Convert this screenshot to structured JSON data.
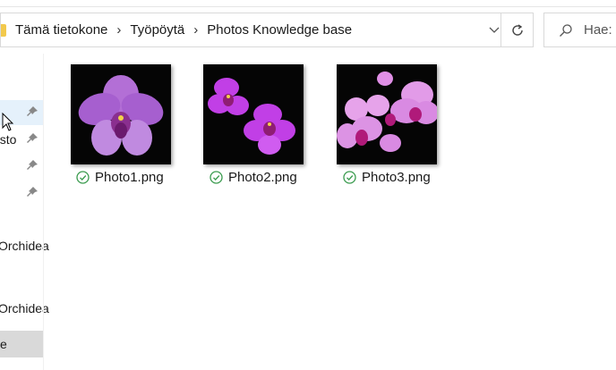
{
  "breadcrumb": [
    "Tämä tietokone",
    "Työpöytä",
    "Photos Knowledge base"
  ],
  "search": {
    "placeholder": "Hae:"
  },
  "sidebar": {
    "items": [
      {
        "label": "osto"
      },
      {
        "label": "Orchidea"
      },
      {
        "label": "Orchidea"
      },
      {
        "label": "e"
      }
    ]
  },
  "files": [
    {
      "name": "Photo1.png",
      "status": "synced"
    },
    {
      "name": "Photo2.png",
      "status": "synced"
    },
    {
      "name": "Photo3.png",
      "status": "synced"
    }
  ],
  "colors": {
    "sync_green": "#3a9b4e",
    "selection": "#e5f1fb",
    "orchid_purple": "#b04fd6"
  }
}
